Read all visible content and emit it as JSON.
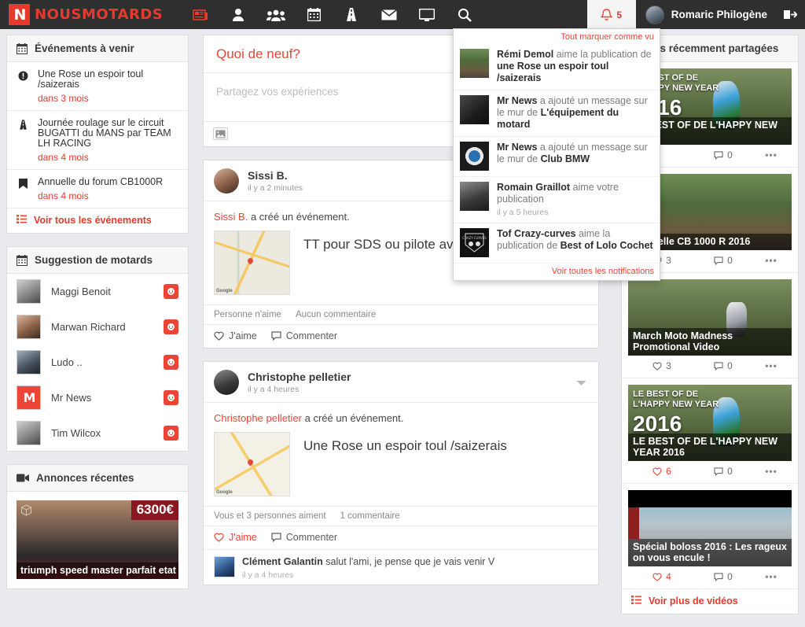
{
  "topbar": {
    "logo_text": "NOUSMOTARDS",
    "logo_mark": "N",
    "nav_icons": [
      "newspaper-icon",
      "user-icon",
      "group-icon",
      "calendar-icon",
      "road-icon",
      "envelope-icon",
      "monitor-icon",
      "search-icon"
    ],
    "bell_count": "5",
    "user_name": "Romaric Philogène",
    "logout_icon": "logout-icon",
    "accent_color": "#ec4437",
    "bar_color": "#2f2f2f"
  },
  "notifications": {
    "mark_all_label": "Tout marquer comme vu",
    "see_all_label": "Voir toutes les notifications",
    "items": [
      {
        "actor": "Rémi Demol",
        "action": " aime la publication de ",
        "target": "une Rose un espoir toul /saizerais",
        "time": "",
        "avatar": "th-road"
      },
      {
        "actor": "Mr News",
        "action": " a ajouté un message sur le mur de ",
        "target": "L'équipement du motard",
        "time": "",
        "avatar": "th-helmet"
      },
      {
        "actor": "Mr News",
        "action": " a ajouté un message sur le mur de ",
        "target": "Club BMW",
        "time": "",
        "avatar": "th-bmw"
      },
      {
        "actor": "Romain Graillot",
        "action": " aime votre publication",
        "target": "",
        "time": "il y a 5 heures",
        "avatar": "th-bike"
      },
      {
        "actor": "Tof Crazy-curves",
        "action": " aime la publication de ",
        "target": "Best of Lolo Cochet",
        "time": "",
        "avatar": "th-crazy"
      }
    ]
  },
  "left": {
    "events": {
      "title": "Événements à venir",
      "icon": "calendar-icon",
      "items": [
        {
          "icon": "info-icon",
          "title": "Une Rose un espoir toul /saizerais",
          "when": "dans 3 mois"
        },
        {
          "icon": "road-icon",
          "title": "Journée roulage sur le circuit BUGATTI du MANS par TEAM LH RACING",
          "when": "dans 4 mois"
        },
        {
          "icon": "bookmark-icon",
          "title": "Annuelle du forum CB1000R",
          "when": "dans 4 mois"
        }
      ],
      "footer_label": "Voir tous les événements",
      "footer_icon": "list-icon"
    },
    "suggestions": {
      "title": "Suggestion de motards",
      "icon": "calendar-icon",
      "items": [
        {
          "name": "Maggi Benoit",
          "avatar": "th-gray",
          "add_icon": "add-user-icon"
        },
        {
          "name": "Marwan Richard",
          "avatar": "th-girl",
          "add_icon": "add-user-icon"
        },
        {
          "name": "Ludo ..",
          "avatar": "th-moto",
          "add_icon": "add-user-icon"
        },
        {
          "name": "Mr News",
          "avatar": "th-mrnews",
          "add_icon": "add-user-icon"
        },
        {
          "name": "Tim Wilcox",
          "avatar": "th-gray",
          "add_icon": "add-user-icon"
        }
      ]
    },
    "ads": {
      "title": "Annonces récentes",
      "icon": "video-icon",
      "items": [
        {
          "price": "6300€",
          "caption": "triumph speed master parfait etat",
          "thumb": "th-ad"
        }
      ]
    }
  },
  "mid": {
    "composer": {
      "title": "Quoi de neuf?",
      "placeholder": "Partagez vos expériences",
      "image_button": "image-icon"
    },
    "posts": [
      {
        "author": "Sissi B.",
        "time": "il y a 2 minutes",
        "avatar": "th-girl",
        "action_author": "Sissi B.",
        "action_text": " a créé un événement.",
        "event_title": "TT pour SDS ou pilote avec billet du ferry",
        "map": "th-map1",
        "likes_text": "Personne n'aime",
        "comments_text": "Aucun commentaire",
        "like_label": "J'aime",
        "comment_label": "Commenter",
        "liked": false,
        "has_caret": false,
        "comments": []
      },
      {
        "author": "Christophe pelletier",
        "time": "il y a 4 heures",
        "avatar": "th-bike",
        "action_author": "Christophe pelletier",
        "action_text": " a créé un événement.",
        "event_title": "Une Rose un espoir toul /saizerais",
        "map": "th-map2",
        "likes_text": "Vous et 3 personnes aiment",
        "comments_text": "1 commentaire",
        "like_label": "J'aime",
        "comment_label": "Commenter",
        "liked": true,
        "has_caret": true,
        "comments": [
          {
            "author": "Clément Galantin",
            "text": " salut l'ami, je pense que je vais venir V",
            "time": "il y a 4 heures",
            "avatar": "th-blue"
          }
        ]
      }
    ]
  },
  "right": {
    "videos": {
      "title": "Vidéos récemment partagées",
      "items": [
        {
          "caption": "LE BEST OF DE L'HAPPY NEW YEAR",
          "likes": "",
          "comments": "0",
          "thumb": "th-forest",
          "overlay": "LE BEST OF DE\nL'HAPPY NEW YEAR",
          "bignum": "2016",
          "liked": false
        },
        {
          "caption": "Annuelle CB 1000 R 2016",
          "likes": "3",
          "comments": "0",
          "thumb": "th-road",
          "overlay": "",
          "bignum": "",
          "liked": false
        },
        {
          "caption": "March Moto Madness Promotional Video",
          "likes": "3",
          "comments": "0",
          "thumb": "th-forest",
          "overlay": "",
          "bignum": "",
          "liked": false
        },
        {
          "caption": "LE BEST OF DE L'HAPPY NEW YEAR 2016",
          "likes": "6",
          "comments": "0",
          "thumb": "th-forest",
          "overlay": "LE BEST OF DE\nL'HAPPY NEW YEAR",
          "bignum": "2016",
          "liked": true
        },
        {
          "caption": "Spécial boloss 2016 : Les rageux on vous encule !",
          "likes": "4",
          "comments": "0",
          "thumb": "th-street",
          "overlay": "",
          "bignum": "",
          "liked": true
        }
      ],
      "footer_label": "Voir plus de vidéos",
      "footer_icon": "list-icon",
      "more_icon": "ellipsis-icon",
      "like_icon": "heart-icon",
      "comment_icon": "comment-icon"
    }
  }
}
